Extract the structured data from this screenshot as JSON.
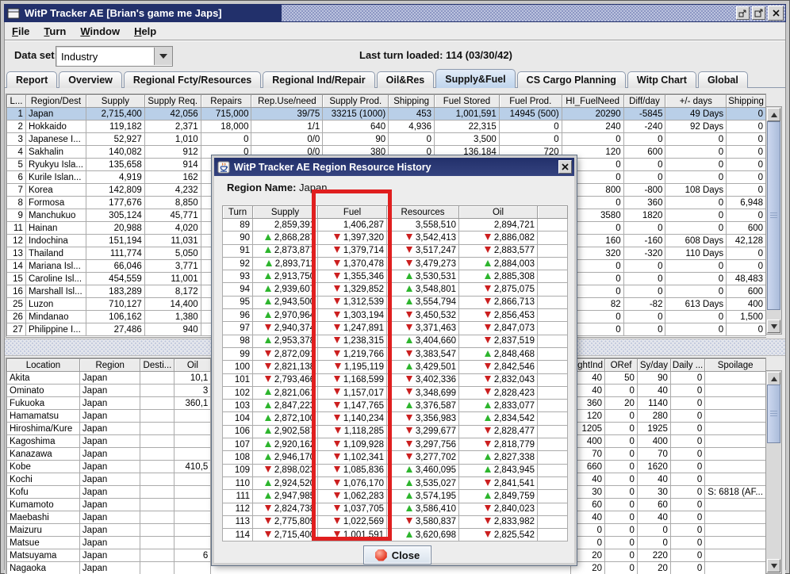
{
  "window": {
    "title": "WitP Tracker AE [Brian's game me Japs]",
    "buttons": [
      "restore",
      "maximize",
      "close"
    ]
  },
  "menu": {
    "items": [
      "File",
      "Turn",
      "Window",
      "Help"
    ]
  },
  "toolbar": {
    "dataset_label": "Data set:",
    "dataset_value": "Industry",
    "last_turn_label": "Last turn loaded: 114 (03/30/42)"
  },
  "tabs": {
    "items": [
      "Report",
      "Overview",
      "Regional Fcty/Resources",
      "Regional Ind/Repair",
      "Oil&Res",
      "Supply&Fuel",
      "CS Cargo Planning",
      "Witp Chart",
      "Global"
    ],
    "selected": "Supply&Fuel"
  },
  "main_table": {
    "columns": [
      "L...",
      "Region/Dest",
      "Supply",
      "Supply Req.",
      "Repairs",
      "Rep.Use/need",
      "Supply Prod.",
      "Shipping",
      "Fuel Stored",
      "Fuel Prod.",
      "HI_FuelNeed",
      "Diff/day",
      "+/- days",
      "Shipping"
    ],
    "selected_row": 0,
    "rows": [
      [
        "1",
        "Japan",
        "2,715,400",
        "42,056",
        "715,000",
        "39/75",
        "33215 (1000)",
        "453",
        "1,001,591",
        "14945 (500)",
        "20290",
        "-5845",
        "49 Days",
        "0"
      ],
      [
        "2",
        "Hokkaido",
        "119,182",
        "2,371",
        "18,000",
        "1/1",
        "640",
        "4,936",
        "22,315",
        "0",
        "240",
        "-240",
        "92 Days",
        "0"
      ],
      [
        "3",
        "Japanese I...",
        "52,927",
        "1,010",
        "0",
        "0/0",
        "90",
        "0",
        "3,500",
        "0",
        "0",
        "0",
        "0",
        "0"
      ],
      [
        "4",
        "Sakhalin",
        "140,082",
        "912",
        "0",
        "0/0",
        "380",
        "0",
        "136,184",
        "720",
        "120",
        "600",
        "0",
        "0"
      ],
      [
        "5",
        "Ryukyu Isla...",
        "135,658",
        "914",
        "",
        "",
        "",
        "",
        "",
        "",
        "0",
        "0",
        "0",
        "0"
      ],
      [
        "6",
        "Kurile Islan...",
        "4,919",
        "162",
        "",
        "",
        "",
        "",
        "",
        "",
        "0",
        "0",
        "0",
        "0"
      ],
      [
        "7",
        "Korea",
        "142,809",
        "4,232",
        "",
        "",
        "",
        "",
        "",
        "",
        "800",
        "-800",
        "108 Days",
        "0"
      ],
      [
        "8",
        "Formosa",
        "177,676",
        "8,850",
        "",
        "",
        "",
        "",
        "",
        "",
        "0",
        "360",
        "0",
        "6,948"
      ],
      [
        "9",
        "Manchukuo",
        "305,124",
        "45,771",
        "",
        "",
        "",
        "",
        "",
        "",
        "3580",
        "1820",
        "0",
        "0"
      ],
      [
        "11",
        "Hainan",
        "20,988",
        "4,020",
        "",
        "",
        "",
        "",
        "",
        "",
        "0",
        "0",
        "0",
        "600"
      ],
      [
        "12",
        "Indochina",
        "151,194",
        "11,031",
        "",
        "",
        "",
        "",
        "",
        "",
        "160",
        "-160",
        "608 Days",
        "42,128"
      ],
      [
        "13",
        "Thailand",
        "111,774",
        "5,050",
        "",
        "",
        "",
        "",
        "",
        "",
        "320",
        "-320",
        "110 Days",
        "0"
      ],
      [
        "14",
        "Mariana Isl...",
        "66,046",
        "3,771",
        "",
        "",
        "",
        "",
        "",
        "",
        "0",
        "0",
        "0",
        "0"
      ],
      [
        "15",
        "Caroline Isl...",
        "454,559",
        "11,001",
        "",
        "",
        "",
        "",
        "",
        "",
        "0",
        "0",
        "0",
        "48,483"
      ],
      [
        "16",
        "Marshall Isl...",
        "183,289",
        "8,172",
        "",
        "",
        "",
        "",
        "",
        "",
        "0",
        "0",
        "0",
        "600"
      ],
      [
        "25",
        "Luzon",
        "710,127",
        "14,400",
        "",
        "",
        "",
        "",
        "",
        "",
        "82",
        "-82",
        "613 Days",
        "400"
      ],
      [
        "26",
        "Mindanao",
        "106,162",
        "1,380",
        "",
        "",
        "",
        "",
        "",
        "",
        "0",
        "0",
        "0",
        "1,500"
      ],
      [
        "27",
        "Philippine I...",
        "27,486",
        "940",
        "",
        "",
        "",
        "",
        "",
        "",
        "0",
        "0",
        "0",
        "0"
      ]
    ]
  },
  "bottom_table": {
    "columns": [
      "Location",
      "Region",
      "Desti...",
      "Oil",
      "",
      "LghtInd",
      "ORef",
      "Sy/day",
      "Daily ...",
      "Spoilage"
    ],
    "rows": [
      [
        "Akita",
        "Japan",
        "",
        "10,1",
        "",
        "40",
        "50",
        "90",
        "0",
        ""
      ],
      [
        "Ominato",
        "Japan",
        "",
        "3",
        "",
        "40",
        "0",
        "40",
        "0",
        ""
      ],
      [
        "Fukuoka",
        "Japan",
        "",
        "360,1",
        "",
        "360",
        "20",
        "1140",
        "0",
        ""
      ],
      [
        "Hamamatsu",
        "Japan",
        "",
        "",
        "",
        "120",
        "0",
        "280",
        "0",
        ""
      ],
      [
        "Hiroshima/Kure",
        "Japan",
        "",
        "",
        "",
        "1205",
        "0",
        "1925",
        "0",
        ""
      ],
      [
        "Kagoshima",
        "Japan",
        "",
        "",
        "",
        "400",
        "0",
        "400",
        "0",
        ""
      ],
      [
        "Kanazawa",
        "Japan",
        "",
        "",
        "",
        "70",
        "0",
        "70",
        "0",
        ""
      ],
      [
        "Kobe",
        "Japan",
        "",
        "410,5",
        "",
        "660",
        "0",
        "1620",
        "0",
        ""
      ],
      [
        "Kochi",
        "Japan",
        "",
        "",
        "",
        "40",
        "0",
        "40",
        "0",
        ""
      ],
      [
        "Kofu",
        "Japan",
        "",
        "",
        "",
        "30",
        "0",
        "30",
        "0",
        "S: 6818 (AF..."
      ],
      [
        "Kumamoto",
        "Japan",
        "",
        "",
        "",
        "60",
        "0",
        "60",
        "0",
        ""
      ],
      [
        "Maebashi",
        "Japan",
        "",
        "",
        "",
        "40",
        "0",
        "40",
        "0",
        ""
      ],
      [
        "Maizuru",
        "Japan",
        "",
        "",
        "",
        "0",
        "0",
        "0",
        "0",
        ""
      ],
      [
        "Matsue",
        "Japan",
        "",
        "",
        "",
        "0",
        "0",
        "0",
        "0",
        ""
      ],
      [
        "Matsuyama",
        "Japan",
        "",
        "6",
        "",
        "20",
        "0",
        "220",
        "0",
        ""
      ],
      [
        "Nagaoka",
        "Japan",
        "",
        "",
        "",
        "20",
        "0",
        "20",
        "0",
        ""
      ]
    ]
  },
  "dialog": {
    "title": "WitP Tracker AE Region Resource History",
    "region_label": "Region Name:",
    "region_value": "Japan",
    "close_label": "Close",
    "columns": [
      "Turn",
      "Supply",
      "Fuel",
      "Resources",
      "Oil",
      ""
    ],
    "rows": [
      [
        "89",
        [
          "2,859,391",
          ""
        ],
        [
          "1,406,287",
          ""
        ],
        [
          "3,558,510",
          ""
        ],
        [
          "2,894,721",
          ""
        ]
      ],
      [
        "90",
        [
          "2,868,287",
          "u"
        ],
        [
          "1,397,320",
          "d"
        ],
        [
          "3,542,413",
          "d"
        ],
        [
          "2,886,082",
          "d"
        ]
      ],
      [
        "91",
        [
          "2,873,877",
          "u"
        ],
        [
          "1,379,714",
          "d"
        ],
        [
          "3,517,247",
          "d"
        ],
        [
          "2,883,577",
          "d"
        ]
      ],
      [
        "92",
        [
          "2,893,711",
          "u"
        ],
        [
          "1,370,478",
          "d"
        ],
        [
          "3,479,273",
          "d"
        ],
        [
          "2,884,003",
          "u"
        ]
      ],
      [
        "93",
        [
          "2,913,750",
          "u"
        ],
        [
          "1,355,346",
          "d"
        ],
        [
          "3,530,531",
          "u"
        ],
        [
          "2,885,308",
          "u"
        ]
      ],
      [
        "94",
        [
          "2,939,607",
          "u"
        ],
        [
          "1,329,852",
          "d"
        ],
        [
          "3,548,801",
          "u"
        ],
        [
          "2,875,075",
          "d"
        ]
      ],
      [
        "95",
        [
          "2,943,500",
          "u"
        ],
        [
          "1,312,539",
          "d"
        ],
        [
          "3,554,794",
          "u"
        ],
        [
          "2,866,713",
          "d"
        ]
      ],
      [
        "96",
        [
          "2,970,964",
          "u"
        ],
        [
          "1,303,194",
          "d"
        ],
        [
          "3,450,532",
          "d"
        ],
        [
          "2,856,453",
          "d"
        ]
      ],
      [
        "97",
        [
          "2,940,374",
          "d"
        ],
        [
          "1,247,891",
          "d"
        ],
        [
          "3,371,463",
          "d"
        ],
        [
          "2,847,073",
          "d"
        ]
      ],
      [
        "98",
        [
          "2,953,378",
          "u"
        ],
        [
          "1,238,315",
          "d"
        ],
        [
          "3,404,660",
          "u"
        ],
        [
          "2,837,519",
          "d"
        ]
      ],
      [
        "99",
        [
          "2,872,091",
          "d"
        ],
        [
          "1,219,766",
          "d"
        ],
        [
          "3,383,547",
          "d"
        ],
        [
          "2,848,468",
          "u"
        ]
      ],
      [
        "100",
        [
          "2,821,138",
          "d"
        ],
        [
          "1,195,119",
          "d"
        ],
        [
          "3,429,501",
          "u"
        ],
        [
          "2,842,546",
          "d"
        ]
      ],
      [
        "101",
        [
          "2,793,466",
          "d"
        ],
        [
          "1,168,599",
          "d"
        ],
        [
          "3,402,336",
          "d"
        ],
        [
          "2,832,043",
          "d"
        ]
      ],
      [
        "102",
        [
          "2,821,061",
          "u"
        ],
        [
          "1,157,017",
          "d"
        ],
        [
          "3,348,699",
          "d"
        ],
        [
          "2,828,423",
          "d"
        ]
      ],
      [
        "103",
        [
          "2,847,223",
          "u"
        ],
        [
          "1,147,765",
          "d"
        ],
        [
          "3,376,587",
          "u"
        ],
        [
          "2,833,077",
          "u"
        ]
      ],
      [
        "104",
        [
          "2,872,100",
          "u"
        ],
        [
          "1,140,234",
          "d"
        ],
        [
          "3,356,983",
          "d"
        ],
        [
          "2,834,542",
          "u"
        ]
      ],
      [
        "106",
        [
          "2,902,587",
          "u"
        ],
        [
          "1,118,285",
          "d"
        ],
        [
          "3,299,677",
          "d"
        ],
        [
          "2,828,477",
          "d"
        ]
      ],
      [
        "107",
        [
          "2,920,162",
          "u"
        ],
        [
          "1,109,928",
          "d"
        ],
        [
          "3,297,756",
          "d"
        ],
        [
          "2,818,779",
          "d"
        ]
      ],
      [
        "108",
        [
          "2,946,170",
          "u"
        ],
        [
          "1,102,341",
          "d"
        ],
        [
          "3,277,702",
          "d"
        ],
        [
          "2,827,338",
          "u"
        ]
      ],
      [
        "109",
        [
          "2,898,023",
          "d"
        ],
        [
          "1,085,836",
          "d"
        ],
        [
          "3,460,095",
          "u"
        ],
        [
          "2,843,945",
          "u"
        ]
      ],
      [
        "110",
        [
          "2,924,520",
          "u"
        ],
        [
          "1,076,170",
          "d"
        ],
        [
          "3,535,027",
          "u"
        ],
        [
          "2,841,541",
          "d"
        ]
      ],
      [
        "111",
        [
          "2,947,985",
          "u"
        ],
        [
          "1,062,283",
          "d"
        ],
        [
          "3,574,195",
          "u"
        ],
        [
          "2,849,759",
          "u"
        ]
      ],
      [
        "112",
        [
          "2,824,738",
          "d"
        ],
        [
          "1,037,705",
          "d"
        ],
        [
          "3,586,410",
          "u"
        ],
        [
          "2,840,023",
          "d"
        ]
      ],
      [
        "113",
        [
          "2,775,809",
          "d"
        ],
        [
          "1,022,569",
          "d"
        ],
        [
          "3,580,837",
          "d"
        ],
        [
          "2,833,982",
          "d"
        ]
      ],
      [
        "114",
        [
          "2,715,400",
          "d"
        ],
        [
          "1,001,591",
          "d"
        ],
        [
          "3,620,698",
          "u"
        ],
        [
          "2,825,542",
          "d"
        ]
      ]
    ]
  },
  "colors": {
    "title_blue": "#22306b",
    "selection_blue": "#b9cfe8",
    "tab_selected": "#bfd4ec",
    "annotation_red": "#e01f1f",
    "arrow_up_green": "#2db52d",
    "arrow_down_red": "#cc1f1f"
  }
}
